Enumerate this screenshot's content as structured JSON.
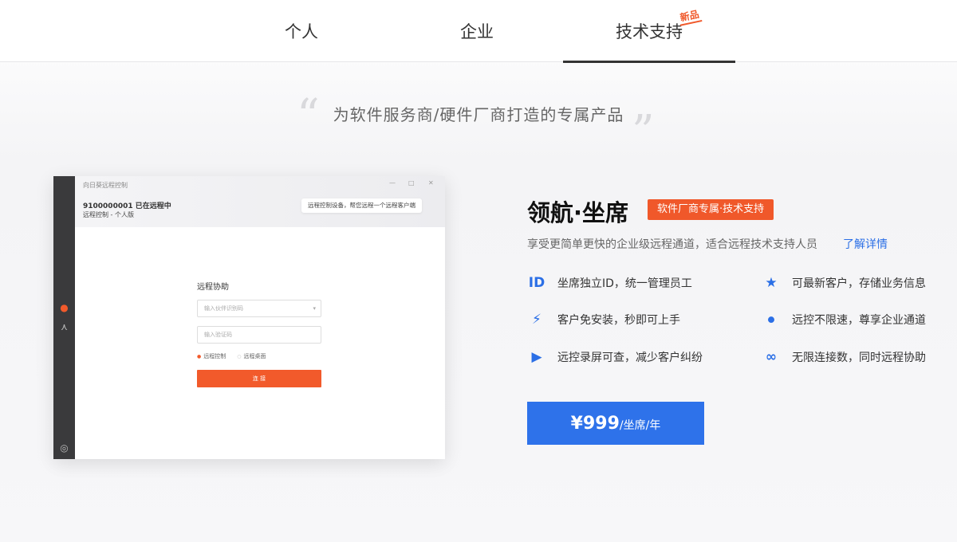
{
  "tabs": [
    {
      "label": "个人"
    },
    {
      "label": "企业"
    },
    {
      "label": "技术支持",
      "badge": "新品"
    }
  ],
  "active_tab": "技术支持",
  "slogan": "为软件服务商/硬件厂商打造的专属产品",
  "preview": {
    "window_title": "向日葵远程控制",
    "id_text": "9100000001 已在远程中",
    "sub_text": "远程控制 - 个人版",
    "bubble_text": "远程控制设备，帮您远程一个远程客户端",
    "form_title": "远程协助",
    "input1_placeholder": "输入伙伴识别码",
    "input2_placeholder": "输入验证码",
    "radio_on": "远程控制",
    "radio_off": "远程桌面",
    "submit_label": "连 接"
  },
  "product": {
    "title": "领航·坐席",
    "tag": "软件厂商专属·技术支持",
    "description": "享受更简单更快的企业级远程通道，适合远程技术支持人员",
    "link": "了解详情",
    "features": [
      {
        "icon": "ID",
        "text": "坐席独立ID，统一管理员工"
      },
      {
        "icon": "★",
        "text": "可最新客户，存储业务信息"
      },
      {
        "icon": "⚡",
        "text": "客户免安装，秒即可上手"
      },
      {
        "icon": "⦁",
        "text": "远控不限速，尊享企业通道"
      },
      {
        "icon": "▶",
        "text": "远控录屏可查，减少客户纠纷"
      },
      {
        "icon": "∞",
        "text": "无限连接数，同时远程协助"
      }
    ],
    "price": "¥999",
    "price_unit": "/坐席/年"
  },
  "colors": {
    "accent_blue": "#2e72ea",
    "accent_orange": "#f0582a"
  }
}
